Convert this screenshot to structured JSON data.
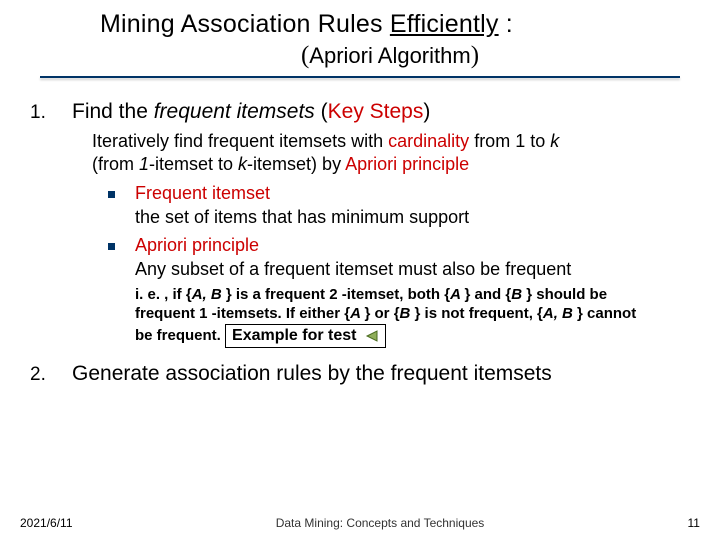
{
  "title": {
    "line1_pre": "Mining Association Rules ",
    "line1_underlined": "Efficiently",
    "line1_post": " :",
    "subtitle": "Apriori Algorithm"
  },
  "step1": {
    "num": "1.",
    "head_pre": "Find the ",
    "head_ital": "frequent itemsets",
    "head_post": " (",
    "head_red": "Key Steps",
    "head_close": ")",
    "para_pre": "Iteratively find frequent itemsets with ",
    "para_red1": "cardinality ",
    "para_mid1": "from 1 to ",
    "para_k": "k",
    "para_line2_pre": "(from ",
    "para_line2_ital1": "1",
    "para_line2_mid1": "-itemset to ",
    "para_line2_ital2": "k",
    "para_line2_mid2": "-itemset) by ",
    "para_line2_red": "Apriori principle",
    "sub1_head": "Frequent itemset",
    "sub1_body": "the set of items that has minimum support",
    "sub2_head": "Apriori principle",
    "sub2_body": "Any subset of a frequent itemset must also be frequent",
    "ie_pre": "i. e. , if {",
    "ie_ab": "A, B ",
    "ie_mid1": "} is a frequent 2 -itemset, both {",
    "ie_a": "A ",
    "ie_mid2": "} and {",
    "ie_b": "B ",
    "ie_mid3": "} should be frequent 1 -itemsets. If either {",
    "ie_a2": "A ",
    "ie_mid4": "} or {",
    "ie_b2": "B ",
    "ie_mid5": "} is not frequent, {",
    "ie_ab2": "A, B ",
    "ie_end": "} cannot be frequent.",
    "example_label": "Example for test"
  },
  "step2": {
    "num": "2.",
    "text": "Generate association rules by the frequent itemsets"
  },
  "footer": {
    "date": "2021/6/11",
    "center": "Data Mining: Concepts and Techniques",
    "page": "11"
  },
  "icons": {
    "play": "play-left-icon"
  }
}
